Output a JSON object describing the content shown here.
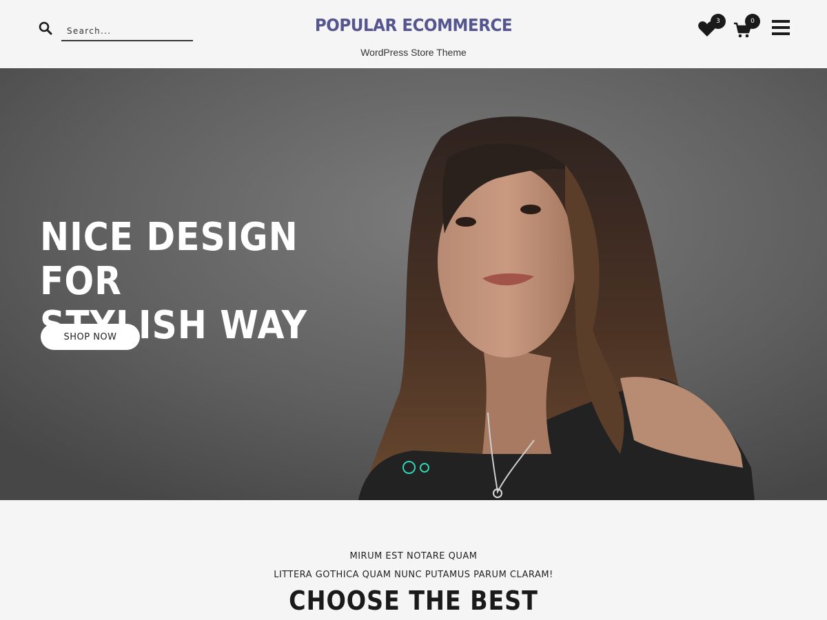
{
  "header": {
    "search": {
      "placeholder": "Search..."
    },
    "site_title": "POPULAR ECOMMERCE",
    "tagline": "WordPress Store Theme",
    "wishlist_count": "3",
    "cart_count": "0"
  },
  "hero": {
    "heading_line1": "NICE DESIGN FOR",
    "heading_line2": "STYLISH WAY",
    "button_label": "SHOP NOW",
    "slider_dots": 2,
    "active_slide": 1,
    "accent_color": "#2fd6b4"
  },
  "section": {
    "subtitle1": "MIRUM EST NOTARE QUAM",
    "subtitle2": "LITTERA GOTHICA QUAM NUNC PUTAMUS PARUM CLARAM!",
    "heading": "CHOOSE THE BEST"
  },
  "colors": {
    "title": "#555590",
    "badge": "#1a1a1a",
    "background": "#f5f5f5"
  }
}
